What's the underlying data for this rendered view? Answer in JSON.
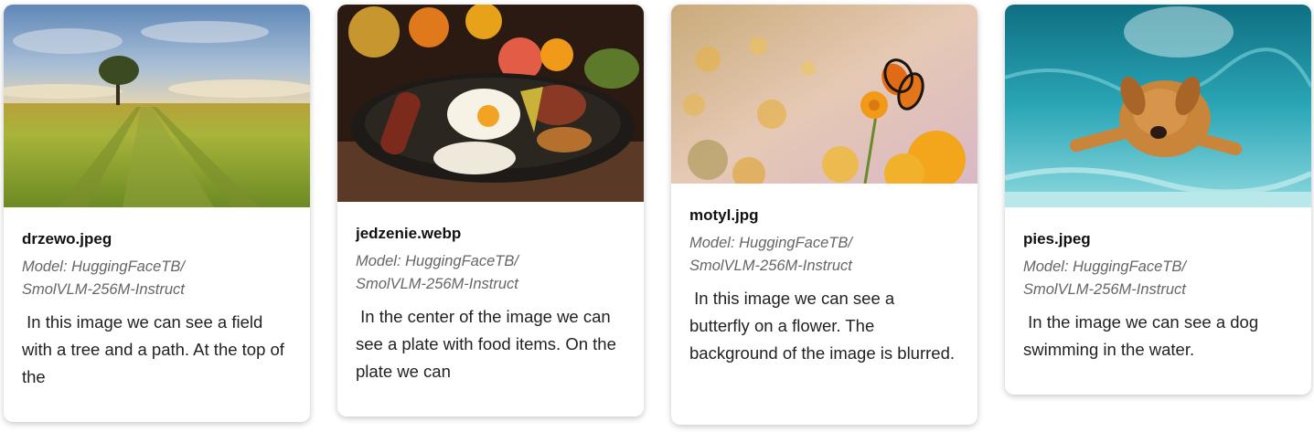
{
  "cards": [
    {
      "filename": "drzewo.jpeg",
      "model_line1": "Model: HuggingFaceTB/",
      "model_line2": "SmolVLM-256M-Instruct",
      "description": " In this image we can see a field with a tree and a path. At the top of the",
      "image_icon": "field-with-tree-image"
    },
    {
      "filename": "jedzenie.webp",
      "model_line1": "Model: HuggingFaceTB/",
      "model_line2": "SmolVLM-256M-Instruct",
      "description": " In the center of the image we can see a plate with food items. On the plate we can",
      "image_icon": "food-plate-image"
    },
    {
      "filename": "motyl.jpg",
      "model_line1": "Model: HuggingFaceTB/",
      "model_line2": "SmolVLM-256M-Instruct",
      "description": " In this image we can see a butterfly on a flower. The background of the image is blurred.",
      "image_icon": "butterfly-image"
    },
    {
      "filename": "pies.jpeg",
      "model_line1": "Model: HuggingFaceTB/",
      "model_line2": "SmolVLM-256M-Instruct",
      "description": " In the image we can see a dog swimming in the water.",
      "image_icon": "dog-swimming-image"
    }
  ]
}
